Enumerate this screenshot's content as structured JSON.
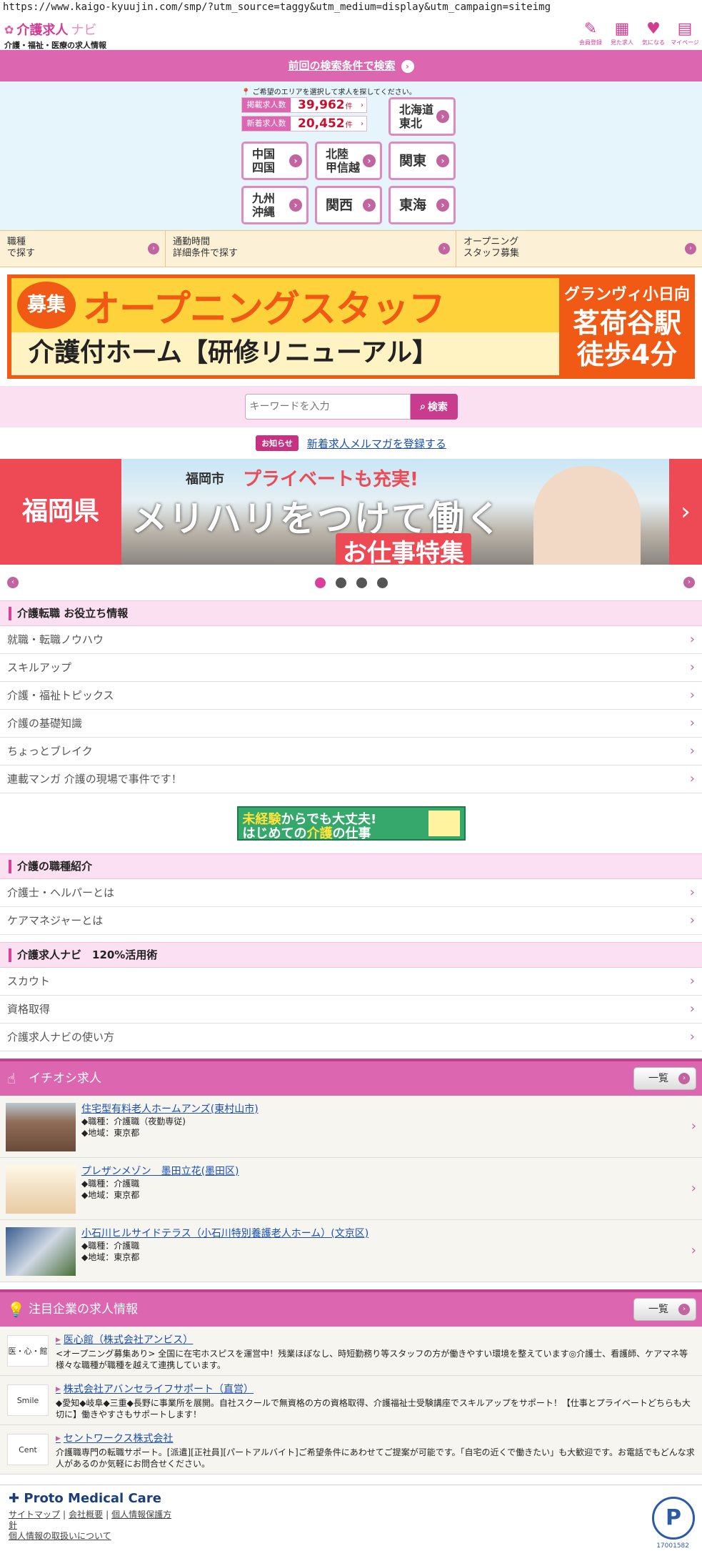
{
  "url": "https://www.kaigo-kyuujin.com/smp/?utm_source=taggy&utm_medium=display&utm_campaign=siteimg",
  "header": {
    "logo_main": "介護求人",
    "logo_navi": "ナビ",
    "logo_sub": "介護・福祉・医療の求人情報",
    "icons": [
      {
        "name": "pencil-icon",
        "label": "会員登録"
      },
      {
        "name": "calendar-icon",
        "label": "見た求人"
      },
      {
        "name": "heart-icon",
        "label": "気になる"
      },
      {
        "name": "mypage-icon",
        "label": "マイページ"
      }
    ]
  },
  "prev_search": {
    "label": "前回の検索条件で検索"
  },
  "areas": {
    "note": "ご希望のエリアを選択して求人を探してください。",
    "counts": [
      {
        "label": "掲載求人数",
        "value": "39,962",
        "unit": "件"
      },
      {
        "label": "新着求人数",
        "value": "20,452",
        "unit": "件"
      }
    ],
    "buttons": [
      "北海道\n東北",
      "中国\n四国",
      "北陸\n甲信越",
      "関東",
      "九州\n沖縄",
      "関西",
      "東海"
    ]
  },
  "categories": [
    {
      "label": "職種\nで探す"
    },
    {
      "label": "通勤時間\n詳細条件で探す"
    },
    {
      "label": "オープニング\nスタッフ募集"
    }
  ],
  "banner1": {
    "badge": "募集",
    "title": "オープニングスタッフ",
    "subtitle": "介護付ホーム【研修リニューアル】",
    "facility": "グランヴィ小日向",
    "station": "茗荷谷駅",
    "walk": "徒歩4分"
  },
  "search": {
    "placeholder": "キーワードを入力",
    "button": "検索"
  },
  "notice": {
    "tag": "お知らせ",
    "link": "新着求人メルマガを登録する"
  },
  "banner2": {
    "left": "福岡県",
    "city": "福岡市",
    "catch": "プライベートも充実!",
    "main": "メリハリをつけて働く",
    "sub": "お仕事特集"
  },
  "sections": {
    "tips": {
      "title": "介護転職 お役立ち情報",
      "items": [
        "就職・転職ノウハウ",
        "スキルアップ",
        "介護・福祉トピックス",
        "介護の基礎知識",
        "ちょっとブレイク",
        "連載マンガ 介護の現場で事件です！"
      ]
    },
    "mid_banner": {
      "l1a": "未経験",
      "l1b": "からでも大丈夫!",
      "l2a": "はじめての",
      "l2b": "介護",
      "l2c": "の仕事"
    },
    "jobs_intro": {
      "title": "介護の職種紹介",
      "items": [
        "介護士・ヘルパーとは",
        "ケアマネジャーとは"
      ]
    },
    "usage": {
      "title": "介護求人ナビ　120%活用術",
      "items": [
        "スカウト",
        "資格取得",
        "介護求人ナビの使い方"
      ]
    }
  },
  "featured": {
    "title": "イチオシ求人",
    "more": "一覧",
    "jobs": [
      {
        "title": "住宅型有料老人ホームアンズ(東村山市)",
        "role": "◆職種：介護職（夜勤専従)",
        "area": "◆地域：東京都"
      },
      {
        "title": "プレザンメゾン　墨田立花(墨田区)",
        "role": "◆職種：介護職",
        "area": "◆地域：東京都"
      },
      {
        "title": "小石川ヒルサイドテラス（小石川特別養護老人ホーム）(文京区)",
        "role": "◆職種：介護職",
        "area": "◆地域：東京都"
      }
    ]
  },
  "companies": {
    "title": "注目企業の求人情報",
    "more": "一覧",
    "items": [
      {
        "logo": "医・心・館",
        "name": "医心館（株式会社アンビス）",
        "desc": "<オープニング募集あり> 全国に在宅ホスピスを運営中！残業ほぼなし、時短勤務り等スタッフの方が働きやすい環境を整えています◎介護士、看護師、ケアマネ等様々な職種が職種を越えて連携しています。"
      },
      {
        "logo": "Smile",
        "name": "株式会社アバンセライフサポート（直営）",
        "desc": "◆愛知◆岐阜◆三重◆長野に事業所を展開。自社スクールで無資格の方の資格取得、介護福祉士受験講座でスキルアップをサポート！【仕事とプライベートどちらも大切に】働きやすさもサポートします！"
      },
      {
        "logo": "Cent",
        "name": "セントワークス株式会社",
        "desc": "介護職専門の転職サポート。[派遣][正社員][パートアルバイト]ご希望条件にあわせてご提案が可能です。「自宅の近くで働きたい」も大歓迎です。お電話でもどんな求人があるのか気軽にお問合せください。"
      }
    ]
  },
  "footer": {
    "logo": "Proto Medical Care",
    "links": [
      "サイトマップ",
      "会社概要",
      "個人情報保護方針",
      "個人情報の取扱いについて"
    ],
    "privacy_number": "17001582"
  }
}
